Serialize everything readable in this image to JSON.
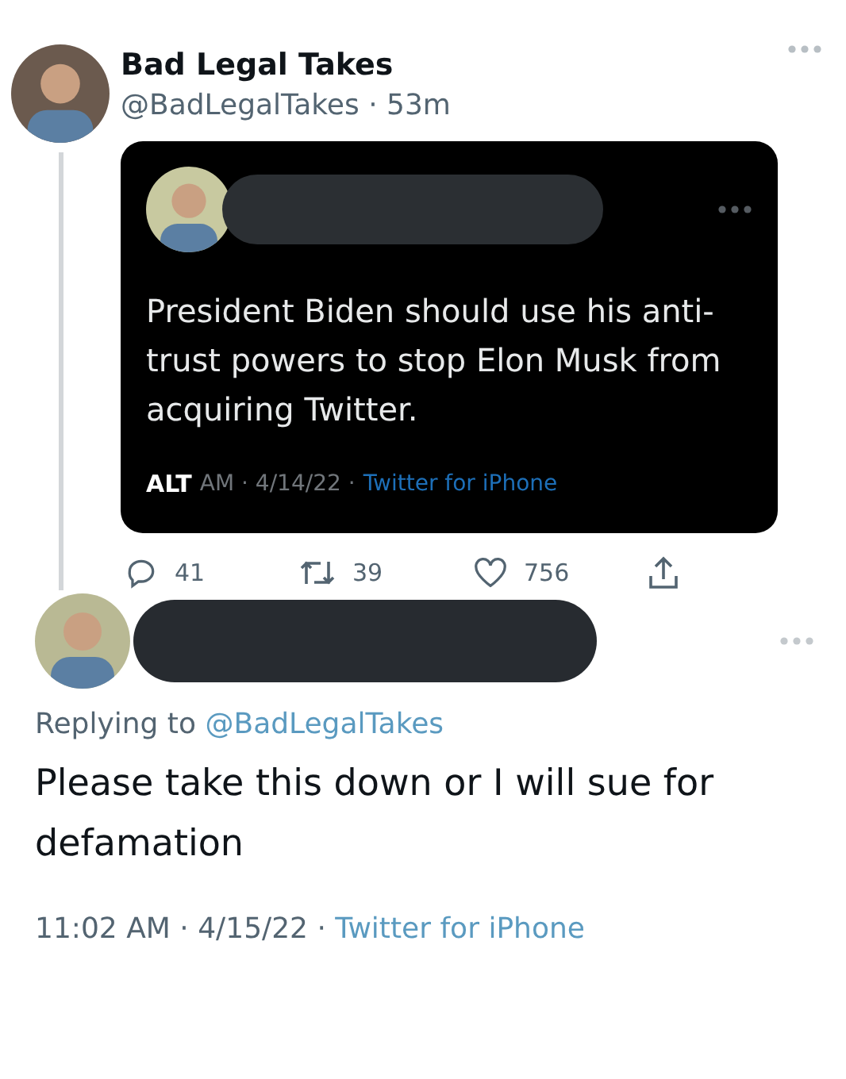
{
  "tweet": {
    "name": "Bad Legal Takes",
    "handle": "@BadLegalTakes",
    "separator": "·",
    "age": "53m",
    "quoted_screenshot": {
      "text": "President Biden should use his anti-trust powers to stop Elon Musk from acquiring Twitter.",
      "alt_badge": "ALT",
      "timestamp": "AM · 4/14/22 ·",
      "source": "Twitter for iPhone"
    },
    "actions": [
      {
        "kind": "reply",
        "count": "41"
      },
      {
        "kind": "retweet",
        "count": "39"
      },
      {
        "kind": "like",
        "count": "756"
      },
      {
        "kind": "share"
      }
    ]
  },
  "reply": {
    "replying_label": "Replying to",
    "replying_handle": "@BadLegalTakes",
    "text": "Please take this down or I will sue for defamation",
    "timestamp": "11:02 AM · 4/15/22 ·",
    "source": "Twitter for iPhone"
  }
}
